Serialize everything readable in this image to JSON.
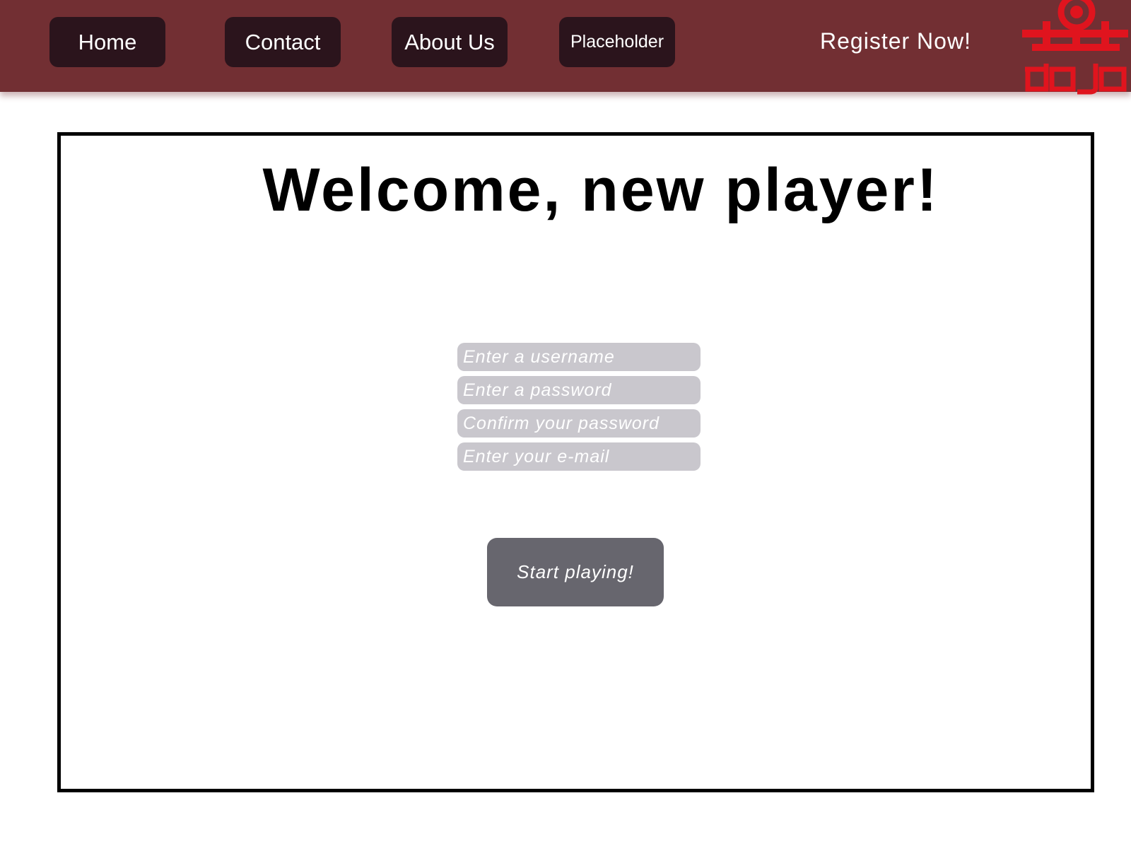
{
  "nav": {
    "items": [
      {
        "label": "Home"
      },
      {
        "label": "Contact"
      },
      {
        "label": "About Us"
      },
      {
        "label": "Placeholder"
      }
    ],
    "register_label": "Register Now!",
    "logo_text": "DOJO"
  },
  "colors": {
    "topbar": "#722f33",
    "nav_button": "#2b141c",
    "logo": "#e0141e",
    "input_bg": "#c9c7cd",
    "start_button": "#67666e"
  },
  "main": {
    "title": "Welcome, new player!",
    "form": {
      "username_placeholder": "Enter a username",
      "password_placeholder": "Enter a password",
      "confirm_placeholder": "Confirm your password",
      "email_placeholder": "Enter your e-mail"
    },
    "start_label": "Start playing!"
  }
}
